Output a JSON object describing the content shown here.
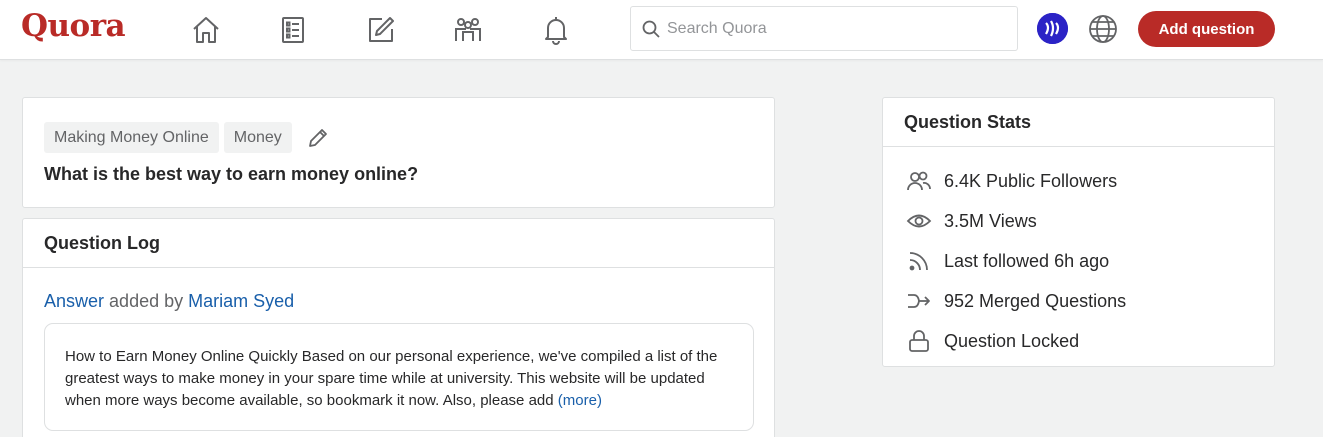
{
  "header": {
    "logo": "Quora",
    "search_placeholder": "Search Quora",
    "add_question": "Add question"
  },
  "question": {
    "topics": [
      "Making Money Online",
      "Money"
    ],
    "title": "What is the best way to earn money online?"
  },
  "log": {
    "heading": "Question Log",
    "entry_link": "Answer",
    "entry_middle": "added by",
    "entry_author": "Mariam Syed",
    "answer_text": "How to Earn Money Online Quickly Based on our personal experience, we've compiled a list of the greatest ways to make money in your spare time while at university. This website will be updated when more ways become available, so bookmark it now. Also, please add",
    "more_label": "(more)"
  },
  "stats": {
    "heading": "Question Stats",
    "items": [
      {
        "icon": "followers-icon",
        "label": "6.4K Public Followers"
      },
      {
        "icon": "eye-icon",
        "label": "3.5M Views"
      },
      {
        "icon": "rss-icon",
        "label": "Last followed 6h ago"
      },
      {
        "icon": "merge-icon",
        "label": "952 Merged Questions"
      },
      {
        "icon": "lock-icon",
        "label": "Question Locked"
      }
    ]
  },
  "colors": {
    "brand": "#b92b27",
    "link": "#195faa",
    "background": "#f1f2f2"
  }
}
